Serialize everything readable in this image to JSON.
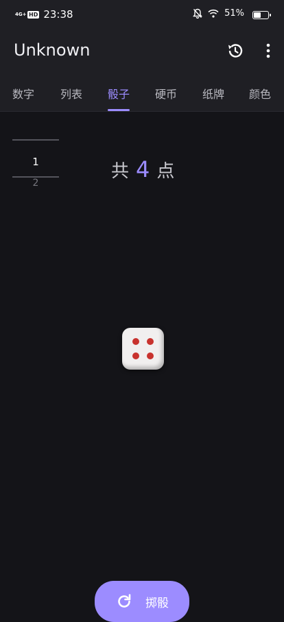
{
  "status_bar": {
    "network": "4G+",
    "hd_badge": "HD",
    "time": "23:38",
    "battery_percent": "51%",
    "battery_level": 0.51
  },
  "app_bar": {
    "title": "Unknown",
    "icons": [
      "history-icon",
      "more-vert-icon"
    ]
  },
  "tabs": [
    {
      "label": "数字",
      "active": false
    },
    {
      "label": "列表",
      "active": false
    },
    {
      "label": "骰子",
      "active": true
    },
    {
      "label": "硬币",
      "active": false
    },
    {
      "label": "纸牌",
      "active": false
    },
    {
      "label": "颜色",
      "active": false
    }
  ],
  "history": [
    "1",
    "2"
  ],
  "result": {
    "prefix": "共",
    "value": "4",
    "suffix": "点"
  },
  "die": {
    "face": 4,
    "pip_color": "#c8322e"
  },
  "roll_button": {
    "label": "掷骰",
    "icon": "refresh-icon"
  },
  "colors": {
    "accent": "#9c8cff",
    "background": "#141418",
    "surface": "#1f1f24"
  }
}
